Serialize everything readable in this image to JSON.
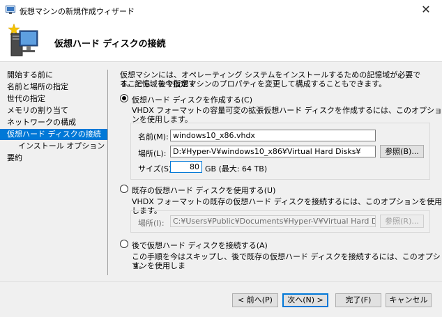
{
  "window": {
    "title": "仮想マシンの新規作成ウィザード",
    "close_glyph": "✕"
  },
  "header": {
    "title": "仮想ハード ディスクの接続"
  },
  "sidebar": {
    "items": [
      {
        "label": "開始する前に"
      },
      {
        "label": "名前と場所の指定"
      },
      {
        "label": "世代の指定"
      },
      {
        "label": "メモリの割り当て"
      },
      {
        "label": "ネットワークの構成"
      },
      {
        "label": "仮想ハード ディスクの接続",
        "selected": true
      },
      {
        "label": "インストール オプション"
      },
      {
        "label": "要約"
      }
    ]
  },
  "intro": {
    "line1": "仮想マシンには、オペレーティング システムをインストールするための記憶域が必要です。記憶域を今指定す",
    "line2": "ることも、後で仮想マシンのプロパティを変更して構成することもできます。"
  },
  "option_create": {
    "label": "仮想ハード ディスクを作成する(C)",
    "desc": "VHDX フォーマットの容量可変の拡張仮想ハード ディスクを作成するには、このオプションを使用します。",
    "name_label": "名前(M):",
    "name_value": "windows10_x86.vhdx",
    "location_label": "場所(L):",
    "location_value": "D:¥Hyper-V¥windows10_x86¥Virtual Hard Disks¥",
    "browse_label": "参照(B)...",
    "size_label": "サイズ(S):",
    "size_value": "80",
    "size_unit": "GB (最大: 64 TB)"
  },
  "option_existing": {
    "label": "既存の仮想ハード ディスクを使用する(U)",
    "desc": "VHDX フォーマットの既存の仮想ハード ディスクを接続するには、このオプションを使用します。",
    "location_label": "場所(I):",
    "location_value": "C:¥Users¥Public¥Documents¥Hyper-V¥Virtual Hard Disks¥",
    "browse_label": "参照(R)..."
  },
  "option_later": {
    "label": "後で仮想ハード ディスクを接続する(A)",
    "desc_line1": "この手順を今はスキップし、後で既存の仮想ハード ディスクを接続するには、このオプションを使用しま",
    "desc_line2": "す。"
  },
  "footer": {
    "prev_label": "< 前へ(P)",
    "next_label": "次へ(N) >",
    "finish_label": "完了(F)",
    "cancel_label": "キャンセル"
  },
  "colors": {
    "accent": "#0078d7",
    "selected_text": "#ffffff"
  }
}
